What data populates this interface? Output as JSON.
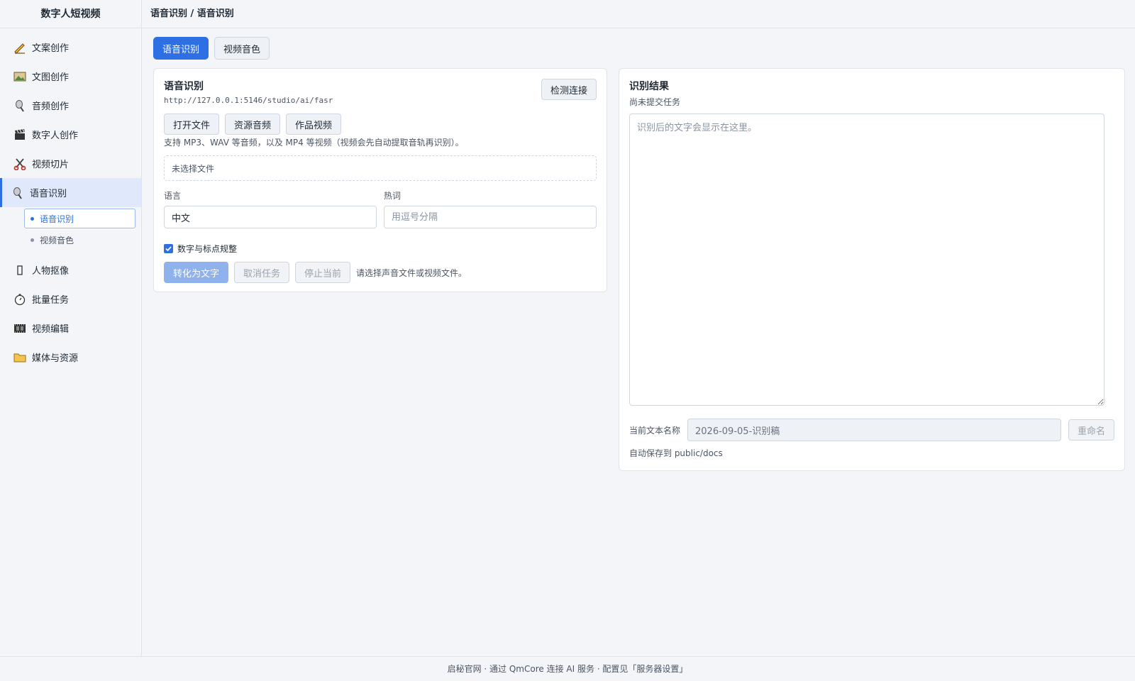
{
  "app": {
    "title": "数字人短视频"
  },
  "breadcrumb": "语音识别 / 语音识别",
  "sidebar": {
    "items": [
      {
        "label": "文案创作",
        "icon": "pencil-icon"
      },
      {
        "label": "文图创作",
        "icon": "picture-icon"
      },
      {
        "label": "音频创作",
        "icon": "microphone-icon"
      },
      {
        "label": "数字人创作",
        "icon": "clapperboard-icon"
      },
      {
        "label": "视频切片",
        "icon": "scissors-icon"
      },
      {
        "label": "语音识别",
        "icon": "microphone-icon",
        "active": true
      },
      {
        "label": "人物抠像",
        "icon": "rectangle-icon"
      },
      {
        "label": "批量任务",
        "icon": "stopwatch-icon"
      },
      {
        "label": "视频编辑",
        "icon": "film-icon"
      },
      {
        "label": "媒体与资源",
        "icon": "folder-icon"
      }
    ],
    "sub_items": [
      {
        "label": "语音识别",
        "active": true
      },
      {
        "label": "视频音色",
        "active": false
      }
    ]
  },
  "tabs": [
    {
      "label": "语音识别",
      "active": true
    },
    {
      "label": "视频音色",
      "active": false
    }
  ],
  "asr_panel": {
    "title": "语音识别",
    "url": "http://127.0.0.1:5146/studio/ai/fasr",
    "detect_button": "检测连接",
    "source_buttons": [
      "打开文件",
      "资源音频",
      "作品视频"
    ],
    "hint": "支持 MP3、WAV 等音频，以及 MP4 等视频（视频会先自动提取音轨再识别）。",
    "file_status": "未选择文件",
    "language_label": "语言",
    "language_value": "中文",
    "hotwords_label": "热词",
    "hotwords_placeholder": "用逗号分隔",
    "normalize_label": "数字与标点规整",
    "normalize_checked": true,
    "convert_button": "转化为文字",
    "cancel_button": "取消任务",
    "stop_button": "停止当前",
    "status_text": "请选择声音文件或视频文件。"
  },
  "result_panel": {
    "title": "识别结果",
    "subtitle": "尚未提交任务",
    "textarea_placeholder": "识别后的文字会显示在这里。",
    "name_label": "当前文本名称",
    "name_value": "2026-09-05-识别稿",
    "rename_button": "重命名",
    "save_note": "自动保存到 public/docs"
  },
  "footer": "启秘官网 · 通过 QmCore 连接 AI 服务 · 配置见「服务器设置」",
  "colors": {
    "accent": "#2f6fe4",
    "active_bg": "#dfe9fb"
  }
}
